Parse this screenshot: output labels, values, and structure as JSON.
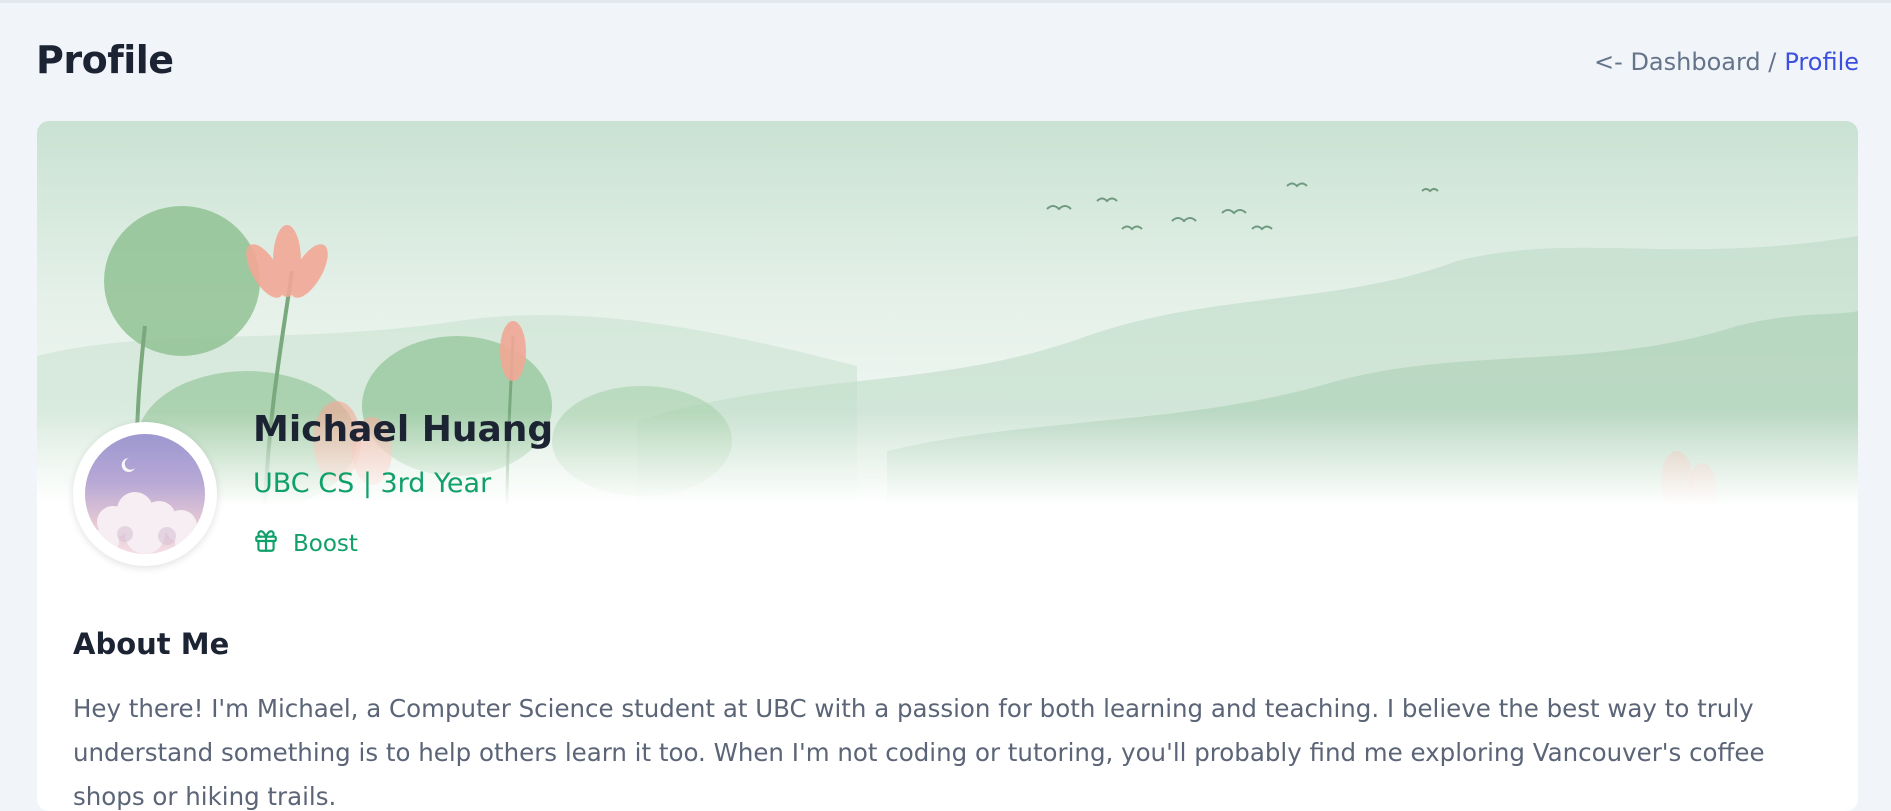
{
  "page": {
    "title": "Profile"
  },
  "breadcrumb": {
    "dashboard_link": "<- Dashboard /",
    "current": "Profile"
  },
  "profile": {
    "name": "Michael Huang",
    "subtitle": "UBC CS | 3rd Year",
    "boost_label": "Boost"
  },
  "about": {
    "title": "About Me",
    "text": "Hey there! I'm Michael, a Computer Science student at UBC with a passion for both learning and teaching. I believe the best way to truly understand something is to help others learn it too. When I'm not coding or tutoring, you'll probably find me exploring Vancouver's coffee shops or hiking trails."
  },
  "colors": {
    "accent_green": "#10a06a",
    "link_blue": "#3c50e0",
    "heading": "#1c2434",
    "background": "#f1f4f9"
  },
  "icons": {
    "boost": "gift-icon"
  }
}
